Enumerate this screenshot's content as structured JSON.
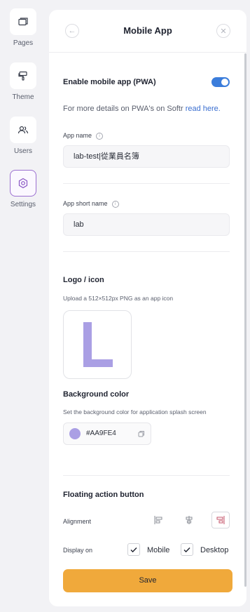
{
  "sidebar": {
    "items": [
      {
        "label": "Pages",
        "icon": "pages-icon"
      },
      {
        "label": "Theme",
        "icon": "paint-roller-icon"
      },
      {
        "label": "Users",
        "icon": "users-icon"
      },
      {
        "label": "Settings",
        "icon": "settings-icon",
        "active": true
      }
    ]
  },
  "panel": {
    "title": "Mobile App"
  },
  "pwa": {
    "toggle_label": "Enable mobile app (PWA)",
    "enabled": true,
    "details_text": "For more details on PWA's on Softr ",
    "details_link": "read here."
  },
  "app_name": {
    "label": "App name",
    "value": "lab-test|從業員名簿"
  },
  "app_short_name": {
    "label": "App short name",
    "value": "lab"
  },
  "logo": {
    "title": "Logo / icon",
    "hint": "Upload a 512×512px PNG as an app icon",
    "letter": "L",
    "color": "#AA9FE4"
  },
  "background": {
    "title": "Background color",
    "hint": "Set the background color for application splash screen",
    "color_value": "#AA9FE4",
    "color": "#AA9FE4"
  },
  "fab": {
    "title": "Floating action button",
    "alignment_label": "Alignment",
    "alignment_options": [
      "align-left-icon",
      "align-center-icon",
      "align-right-icon"
    ],
    "alignment_selected": "right",
    "display_label": "Display on",
    "display_options": [
      {
        "label": "Mobile",
        "checked": true
      },
      {
        "label": "Desktop",
        "checked": true
      }
    ]
  },
  "actions": {
    "save_label": "Save"
  },
  "colors": {
    "accent": "#3B7DDB",
    "save": "#F0A93B",
    "active_border": "#9B6FD0",
    "selected_align": "#C4546B"
  }
}
